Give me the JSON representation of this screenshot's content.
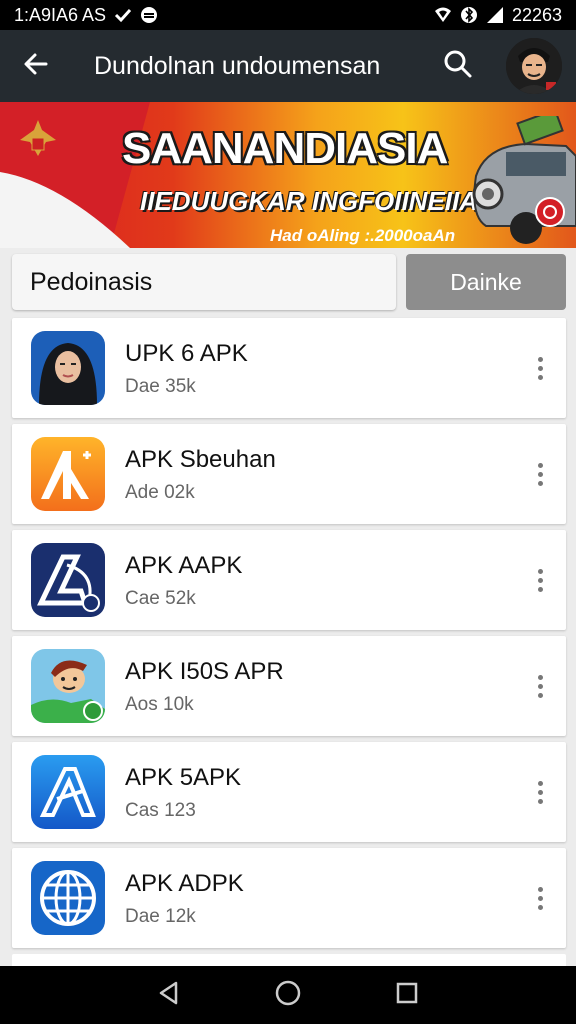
{
  "status_bar": {
    "time": "1:A9IA6 AS",
    "clock": "22263"
  },
  "app_bar": {
    "title": "Dundolnan undoumensan"
  },
  "banner": {
    "headline": "SAANANDIASIA",
    "subheadline": "IIEDUUGKAR INGFOIINEIIA",
    "tagline": "Had oAling :.2000oaAn"
  },
  "filter": {
    "input_text": "Pedoinasis",
    "button_label": "Dainke"
  },
  "apps": [
    {
      "name": "UPK 6 APK",
      "meta": "Dae 35k",
      "icon": "hijab-portrait-icon"
    },
    {
      "name": "APK Sbeuhan",
      "meta": "Ade 02k",
      "icon": "orange-a-plus-icon"
    },
    {
      "name": "APK AAPK",
      "meta": "Cae 52k",
      "icon": "navy-a-logo-icon"
    },
    {
      "name": "APK I50S APR",
      "meta": "Aos 10k",
      "icon": "cartoon-character-icon"
    },
    {
      "name": "APK 5APK",
      "meta": "Cas 123",
      "icon": "blue-a-logo-icon"
    },
    {
      "name": "APK ADPK",
      "meta": "Dae 12k",
      "icon": "globe-icon"
    }
  ],
  "colors": {
    "app_bar": "#252b30",
    "banner_red": "#d91b23",
    "banner_yellow": "#f7c318",
    "filter_button": "#8d8d8d"
  }
}
